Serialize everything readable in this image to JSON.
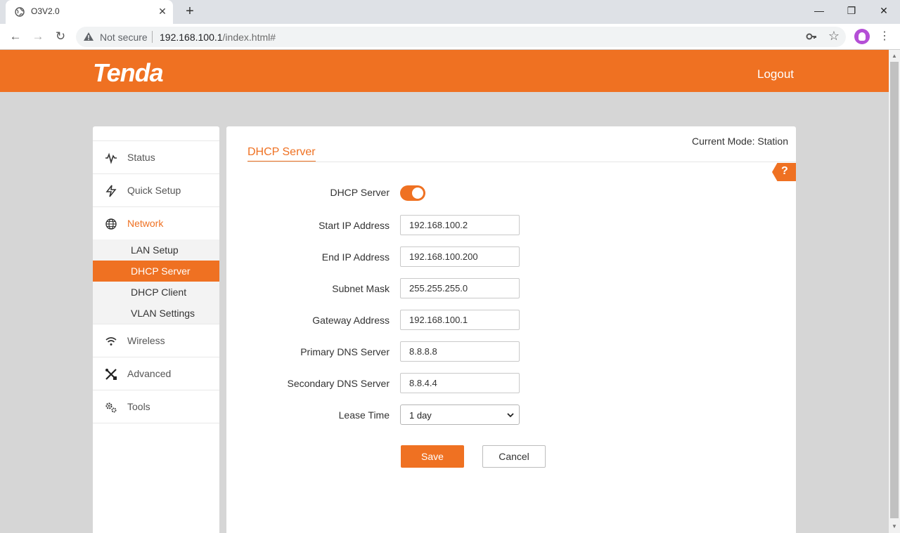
{
  "browser": {
    "tab_title": "O3V2.0",
    "not_secure": "Not secure",
    "url_host": "192.168.100.1",
    "url_path": "/index.html#"
  },
  "header": {
    "logo": "Tenda",
    "logout": "Logout"
  },
  "sidebar": {
    "status": "Status",
    "quick_setup": "Quick Setup",
    "network": "Network",
    "network_sub": {
      "lan_setup": "LAN Setup",
      "dhcp_server": "DHCP Server",
      "dhcp_client": "DHCP Client",
      "vlan_settings": "VLAN Settings"
    },
    "wireless": "Wireless",
    "advanced": "Advanced",
    "tools": "Tools"
  },
  "main": {
    "current_mode": "Current Mode: Station",
    "title": "DHCP Server",
    "help": "?",
    "dhcp_server_label": "DHCP Server",
    "dhcp_server_enabled": true,
    "start_ip_label": "Start IP Address",
    "start_ip": "192.168.100.2",
    "end_ip_label": "End IP Address",
    "end_ip": "192.168.100.200",
    "subnet_label": "Subnet Mask",
    "subnet": "255.255.255.0",
    "gateway_label": "Gateway Address",
    "gateway": "192.168.100.1",
    "primary_dns_label": "Primary DNS Server",
    "primary_dns": "8.8.8.8",
    "secondary_dns_label": "Secondary DNS Server",
    "secondary_dns": "8.8.4.4",
    "lease_label": "Lease Time",
    "lease": "1 day",
    "save": "Save",
    "cancel": "Cancel"
  },
  "colors": {
    "accent": "#ef7122",
    "background": "#d6d6d6"
  }
}
